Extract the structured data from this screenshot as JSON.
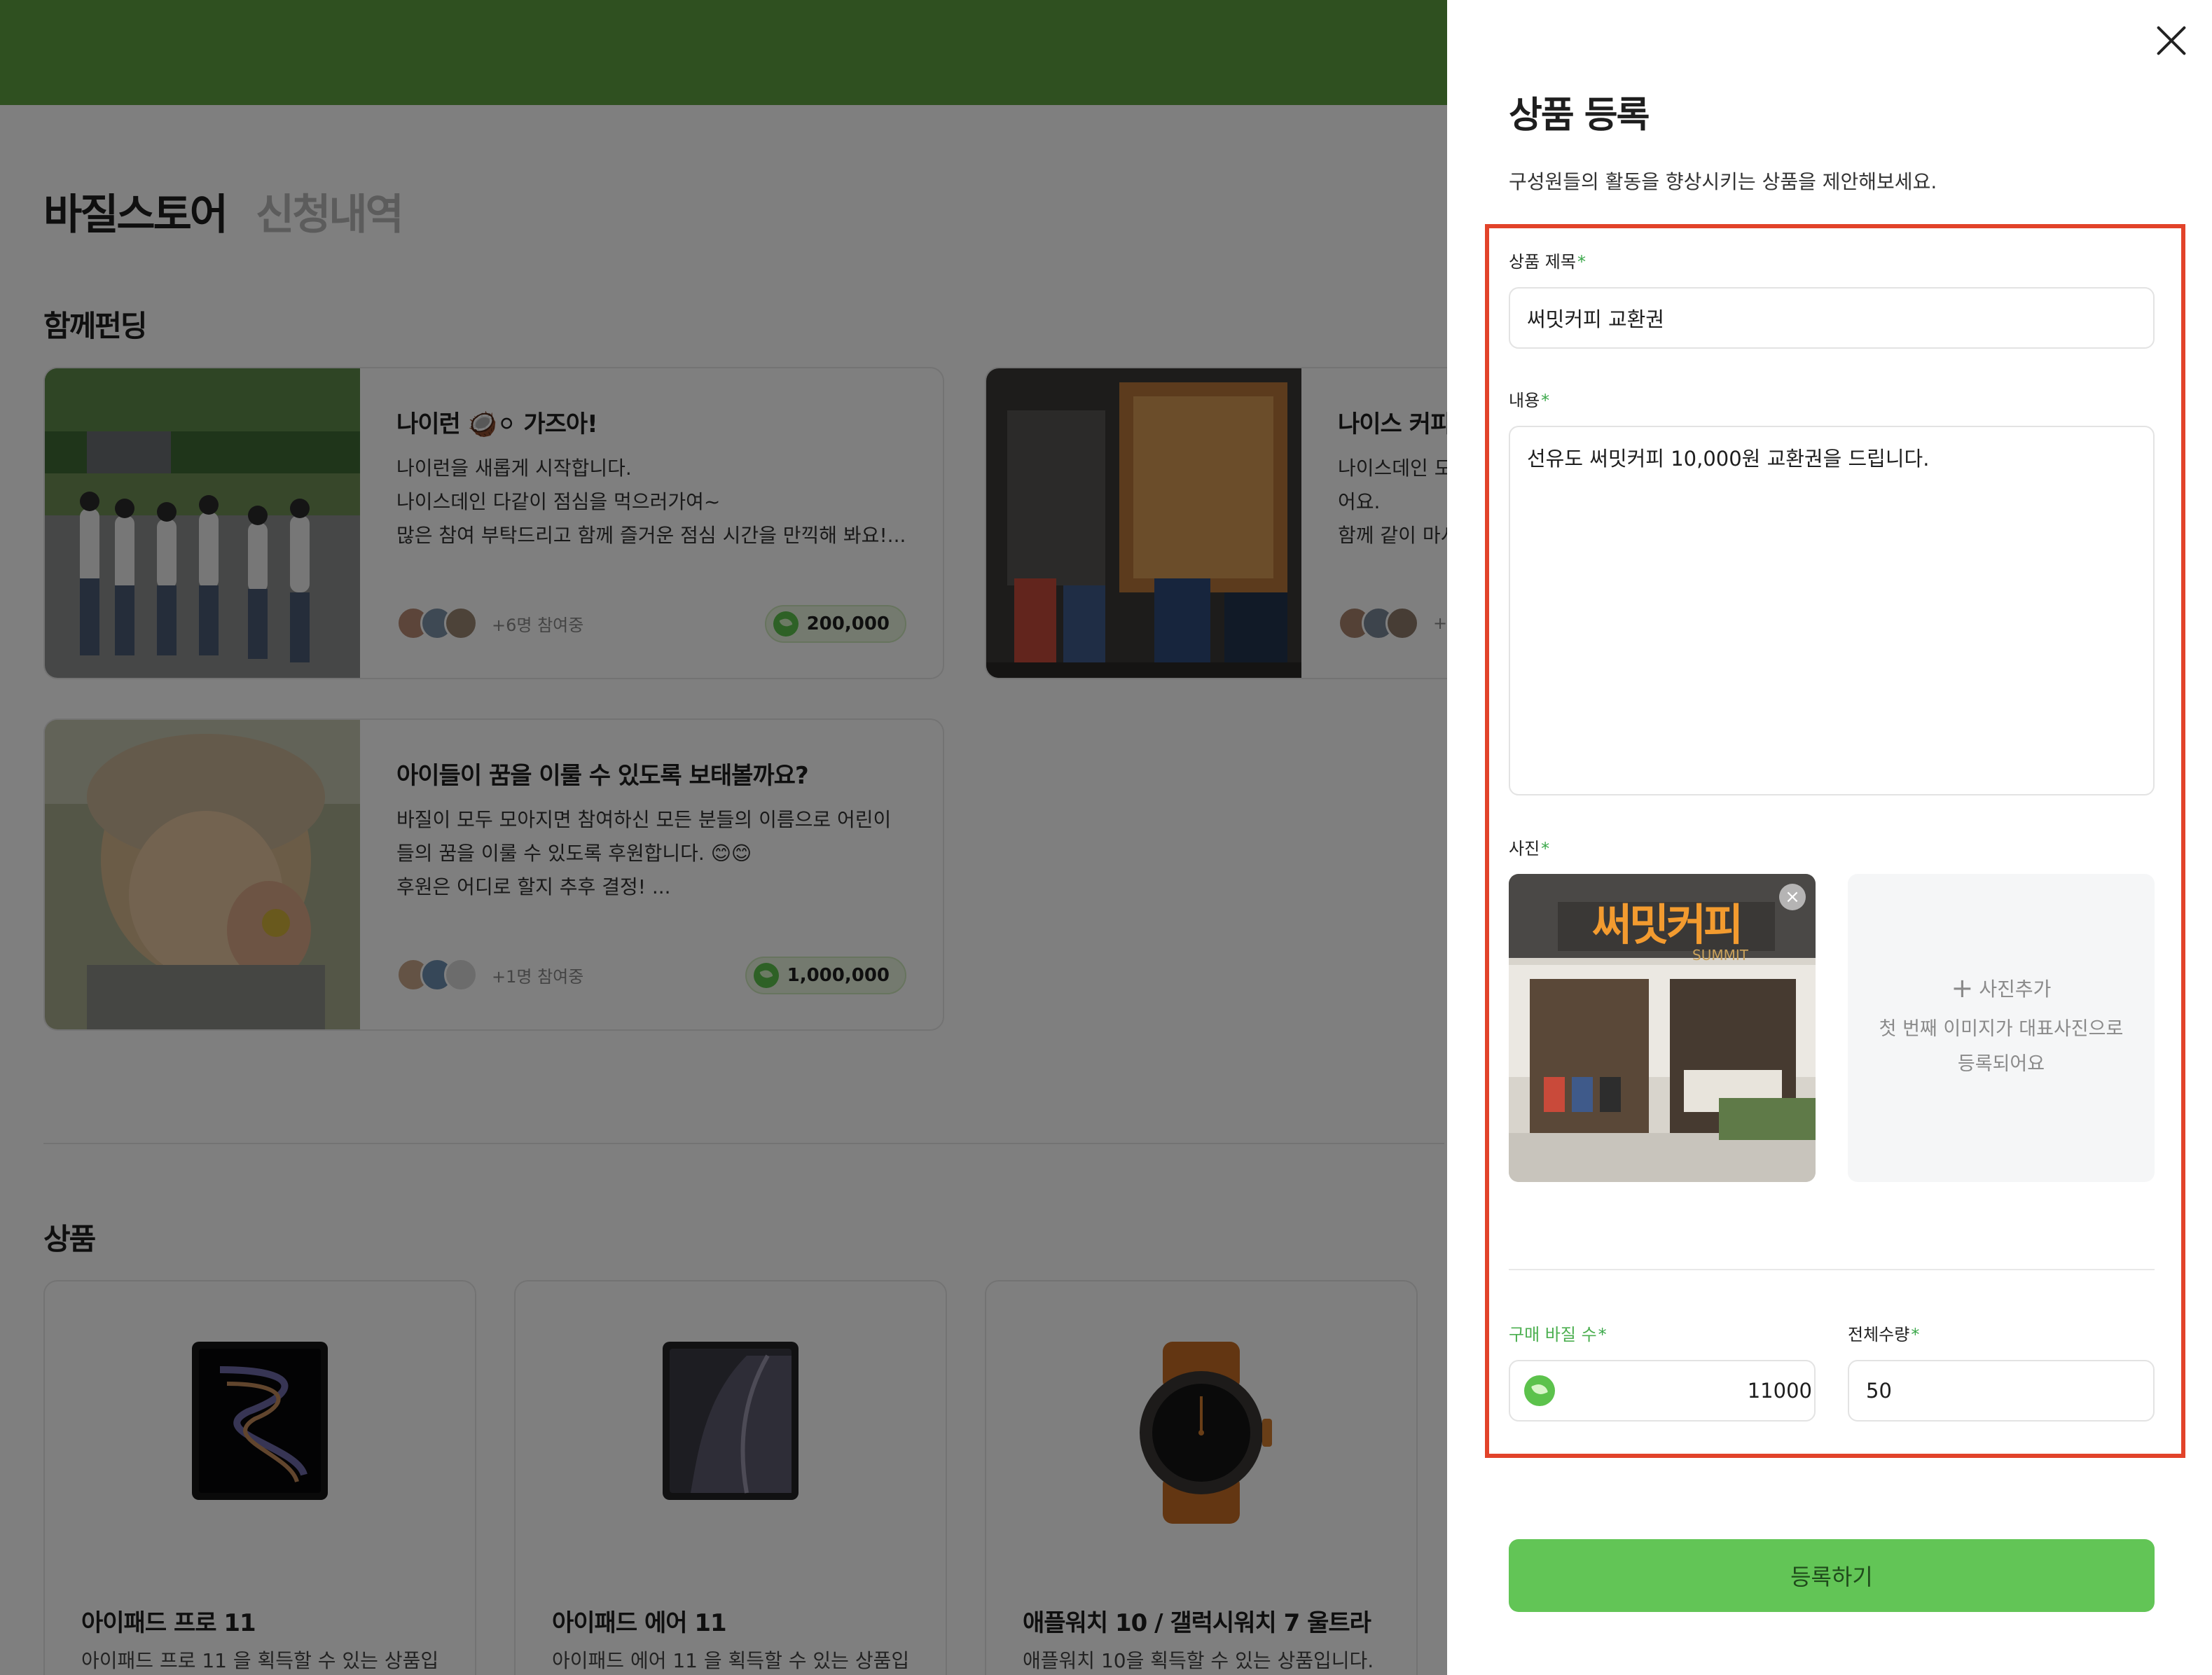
{
  "background": {
    "tabs": [
      {
        "label": "바질스토어",
        "active": true
      },
      {
        "label": "신청내역",
        "active": false
      }
    ],
    "funding_section_title": "함께펀딩",
    "funding_cards": [
      {
        "title": "나이런 🥥⚪ 가즈아!",
        "description": [
          "나이런을 새롭게 시작합니다.",
          "나이스데인 다같이 점심을 먹으러가여~",
          "많은 참여 부탁드리고 함께 즐거운 점심 시간을 만끽해 봐요!..."
        ],
        "participants": "+6명 참여중",
        "amount": "200,000"
      },
      {
        "title": "나이스 커피",
        "description": [
          "나이스데인 모",
          "어요.",
          "함께 같이 마시"
        ],
        "participants": "+",
        "amount": ""
      },
      {
        "title": "아이들이 꿈을 이룰 수 있도록 보태볼까요?",
        "description": [
          "바질이 모두 모아지면 참여하신 모든 분들의 이름으로 어린이",
          "들의 꿈을 이룰 수 있도록 후원합니다. 😊😊",
          "후원은 어디로 할지 추후 결정! ..."
        ],
        "participants": "+1명 참여중",
        "amount": "1,000,000"
      }
    ],
    "products_section_title": "상품",
    "products": [
      {
        "title": "아이패드 프로 11",
        "description": "아이패드 프로 11 을 획득할 수 있는 상품입"
      },
      {
        "title": "아이패드 에어 11",
        "description": "아이패드 에어 11 을 획득할 수 있는 상품입"
      },
      {
        "title": "애플워치 10 / 갤럭시워치 7 울트라",
        "description": "애플워치 10을 획득할 수 있는 상품입니다."
      }
    ]
  },
  "panel": {
    "title": "상품 등록",
    "subtitle": "구성원들의 활동을 향상시키는 상품을 제안해보세요.",
    "fields": {
      "product_title": {
        "label": "상품 제목",
        "value": "써밋커피 교환권"
      },
      "content": {
        "label": "내용",
        "value": "선유도 써밋커피 10,000원 교환권을 드립니다."
      },
      "photo": {
        "label": "사진",
        "sign_text": "써밋커피",
        "sign_subtext": "SUMMIT",
        "remove_symbol": "×",
        "add_label": "사진추가",
        "add_hint": "첫 번째 이미지가 대표사진으로 등록되어요"
      },
      "price": {
        "label": "구매 바질 수",
        "value": "11000"
      },
      "quantity": {
        "label": "전체수량",
        "value": "50"
      }
    },
    "required_mark": "*",
    "submit_label": "등록하기"
  },
  "colors": {
    "brand_green": "#5ea040",
    "submit_green": "#62c556",
    "highlight_red": "#e2432a",
    "required_green": "#3ba84a"
  }
}
